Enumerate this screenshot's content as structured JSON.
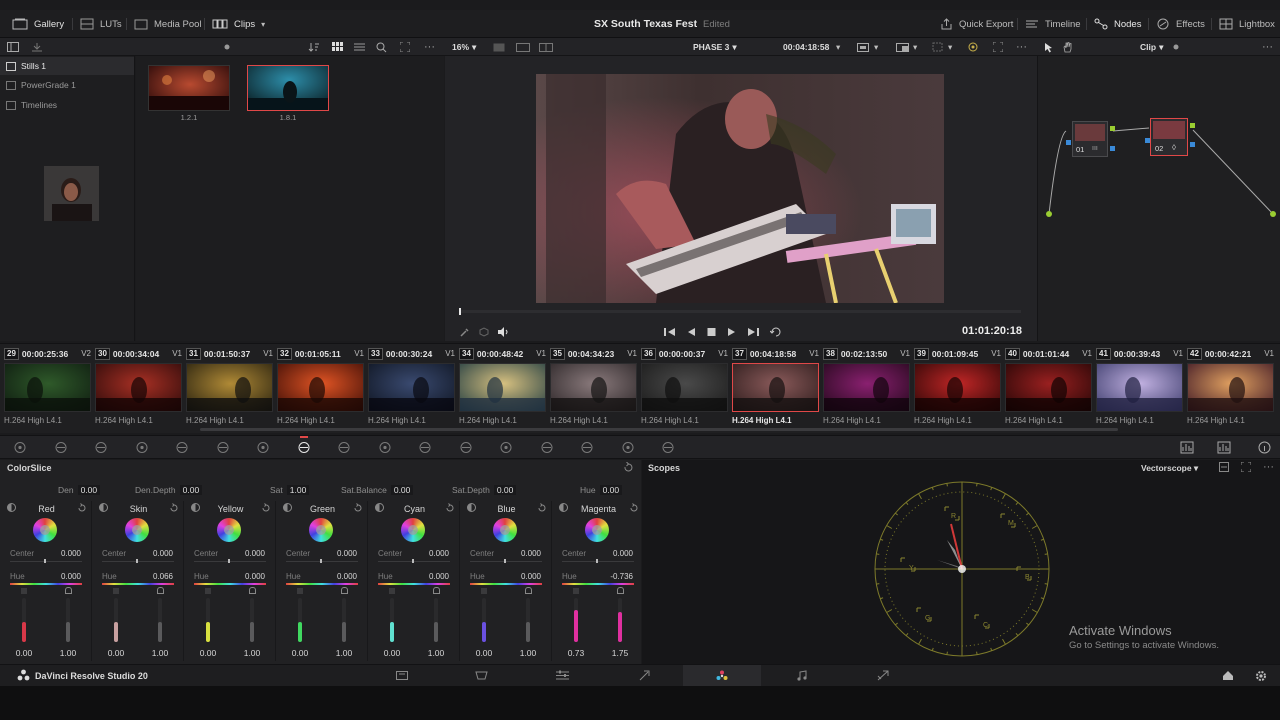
{
  "topbar": {
    "gallery": "Gallery",
    "luts": "LUTs",
    "media_pool": "Media Pool",
    "clips": "Clips",
    "project_title": "SX South Texas Fest",
    "edit_status": "Edited",
    "quick_export": "Quick Export",
    "timeline": "Timeline",
    "nodes": "Nodes",
    "effects": "Effects",
    "lightbox": "Lightbox"
  },
  "viewerbar": {
    "zoom": "16%",
    "phase": "PHASE 3",
    "timecode": "00:04:18:58",
    "mode": "Clip"
  },
  "gallery": {
    "items": [
      "Stills 1",
      "PowerGrade 1",
      "Timelines"
    ],
    "stills": [
      {
        "label": "1.2.1",
        "colors": [
          "#3c1010",
          "#b84a30",
          "#2a0a0a"
        ]
      },
      {
        "label": "1.8.1",
        "colors": [
          "#0f3a48",
          "#2d8eaa",
          "#102024"
        ]
      }
    ]
  },
  "viewer": {
    "timecode": "01:01:20:18"
  },
  "nodes": [
    {
      "label": "01"
    },
    {
      "label": "02"
    }
  ],
  "clips": [
    {
      "num": "29",
      "tc": "00:00:25:36",
      "track": "V2",
      "codec": "H.264 High L4.1",
      "c": [
        "#0e1a10",
        "#2f5a2a",
        "#0a100a"
      ]
    },
    {
      "num": "30",
      "tc": "00:00:34:04",
      "track": "V1",
      "codec": "H.264 High L4.1",
      "c": [
        "#2a0a0a",
        "#a83024",
        "#140404"
      ]
    },
    {
      "num": "31",
      "tc": "00:01:50:37",
      "track": "V1",
      "codec": "H.264 High L4.1",
      "c": [
        "#241e0e",
        "#b08a36",
        "#0e0e0e"
      ]
    },
    {
      "num": "32",
      "tc": "00:01:05:11",
      "track": "V1",
      "codec": "H.264 High L4.1",
      "c": [
        "#3a0c06",
        "#e05424",
        "#1a0804"
      ]
    },
    {
      "num": "33",
      "tc": "00:00:30:24",
      "track": "V1",
      "codec": "H.264 High L4.1",
      "c": [
        "#0e1420",
        "#3a4a70",
        "#080810"
      ]
    },
    {
      "num": "34",
      "tc": "00:00:48:42",
      "track": "V1",
      "codec": "H.264 High L4.1",
      "c": [
        "#1e3a40",
        "#d6c080",
        "#203040"
      ]
    },
    {
      "num": "35",
      "tc": "00:04:34:23",
      "track": "V1",
      "codec": "H.264 High L4.1",
      "c": [
        "#2a2426",
        "#8a7a7c",
        "#141212"
      ]
    },
    {
      "num": "36",
      "tc": "00:00:00:37",
      "track": "V1",
      "codec": "H.264 High L4.1",
      "c": [
        "#1a1a1a",
        "#4a4a4a",
        "#0e0e0e"
      ]
    },
    {
      "num": "37",
      "tc": "00:04:18:58",
      "track": "V1",
      "codec": "H.264 High L4.1",
      "c": [
        "#2a1a1a",
        "#8a5a5a",
        "#141010"
      ]
    },
    {
      "num": "38",
      "tc": "00:02:13:50",
      "track": "V1",
      "codec": "H.264 High L4.1",
      "c": [
        "#22081a",
        "#8a2070",
        "#10040c"
      ]
    },
    {
      "num": "39",
      "tc": "00:01:09:45",
      "track": "V1",
      "codec": "H.264 High L4.1",
      "c": [
        "#2a0606",
        "#c02626",
        "#140303"
      ]
    },
    {
      "num": "40",
      "tc": "00:01:01:44",
      "track": "V1",
      "codec": "H.264 High L4.1",
      "c": [
        "#220606",
        "#9a2020",
        "#100303"
      ]
    },
    {
      "num": "41",
      "tc": "00:00:39:43",
      "track": "V1",
      "codec": "H.264 High L4.1",
      "c": [
        "#3a3a6a",
        "#c0b0e0",
        "#202040"
      ]
    },
    {
      "num": "42",
      "tc": "00:00:42:21",
      "track": "V1",
      "codec": "H.264 High L4.1",
      "c": [
        "#3a1424",
        "#e0a060",
        "#201010"
      ]
    }
  ],
  "colorslice": {
    "title": "ColorSlice",
    "params": [
      {
        "label": "Den",
        "value": "0.00"
      },
      {
        "label": "Den.Depth",
        "value": "0.00"
      },
      {
        "label": "Sat",
        "value": "1.00"
      },
      {
        "label": "Sat.Balance",
        "value": "0.00"
      },
      {
        "label": "Sat.Depth",
        "value": "0.00"
      },
      {
        "label": "Hue",
        "value": "0.00"
      }
    ],
    "center_label": "Center",
    "hue_label": "Hue",
    "vectors": [
      {
        "name": "Red",
        "center": "0.000",
        "hue": "0.000",
        "left": "0.00",
        "right": "1.00",
        "color": "#d83848",
        "fill": 0.45
      },
      {
        "name": "Skin",
        "center": "0.000",
        "hue": "0.066",
        "left": "0.00",
        "right": "1.00",
        "color": "#c8a0a0",
        "fill": 0.45
      },
      {
        "name": "Yellow",
        "center": "0.000",
        "hue": "0.000",
        "left": "0.00",
        "right": "1.00",
        "color": "#d8e040",
        "fill": 0.45
      },
      {
        "name": "Green",
        "center": "0.000",
        "hue": "0.000",
        "left": "0.00",
        "right": "1.00",
        "color": "#40d860",
        "fill": 0.45
      },
      {
        "name": "Cyan",
        "center": "0.000",
        "hue": "0.000",
        "left": "0.00",
        "right": "1.00",
        "color": "#60e0d0",
        "fill": 0.45
      },
      {
        "name": "Blue",
        "center": "0.000",
        "hue": "0.000",
        "left": "0.00",
        "right": "1.00",
        "color": "#6a50e0",
        "fill": 0.45
      },
      {
        "name": "Magenta",
        "center": "0.000",
        "hue": "-0.736",
        "left": "0.73",
        "right": "1.75",
        "color": "#e030a0",
        "fill": 0.73
      }
    ]
  },
  "scopes": {
    "title": "Scopes",
    "type": "Vectorscope",
    "targets": [
      "R",
      "M",
      "B",
      "C",
      "G",
      "Y"
    ]
  },
  "windows": {
    "activate_title": "Activate Windows",
    "activate_sub": "Go to Settings to activate Windows."
  },
  "bottom": {
    "app_name": "DaVinci Resolve Studio 20"
  }
}
